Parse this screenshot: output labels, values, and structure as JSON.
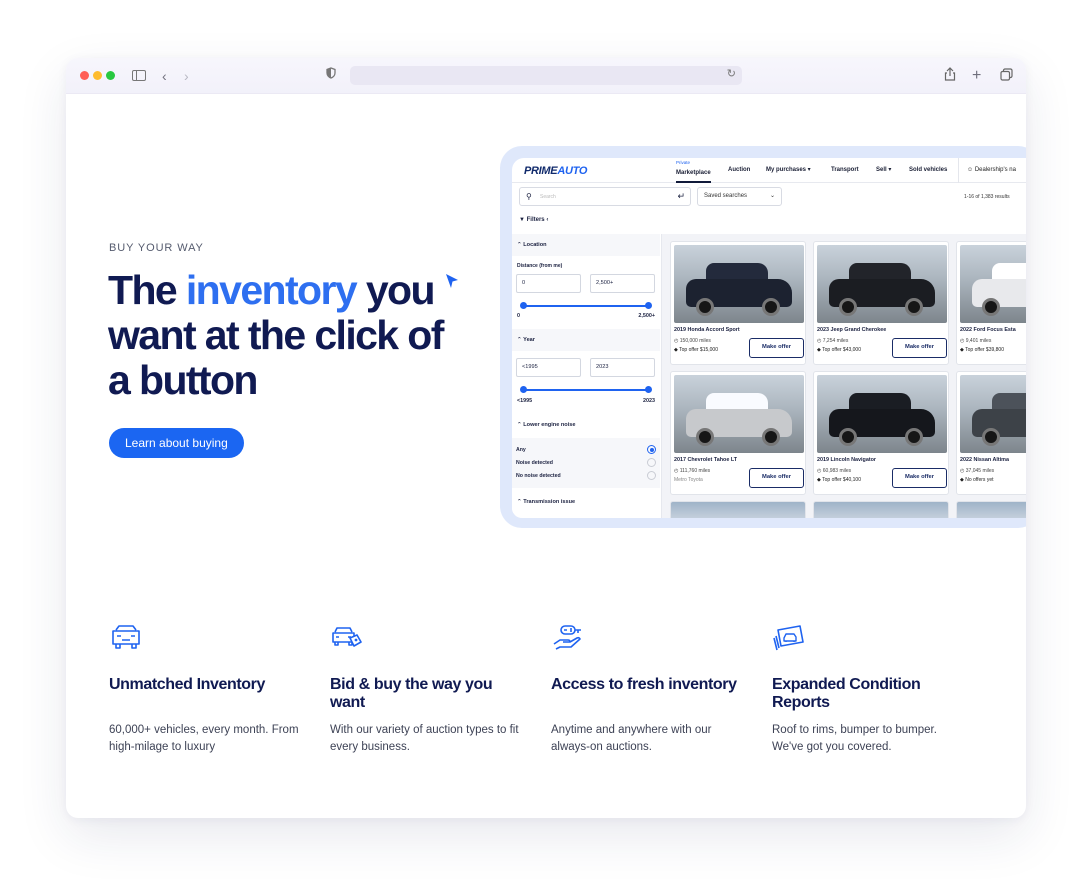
{
  "browser": {
    "window_controls": [
      "close",
      "minimize",
      "zoom"
    ],
    "icons": [
      "sidebar-icon",
      "back-icon",
      "forward-icon",
      "shield-icon",
      "reload-icon",
      "share-icon",
      "new-tab-icon",
      "tabs-overview-icon"
    ]
  },
  "hero": {
    "eyebrow": "BUY YOUR WAY",
    "headline_part1": "The ",
    "headline_accent": "inventory",
    "headline_part2": " you want at the click of a button",
    "cta_label": "Learn about buying",
    "accent_color": "#2e6ff0",
    "heading_color": "#101a52",
    "button_color": "#1b66f2"
  },
  "app": {
    "logo_part1": "PRIME",
    "logo_part2": "AUTO",
    "nav": [
      {
        "label": "Marketplace",
        "super": "Private"
      },
      {
        "label": "Auction"
      },
      {
        "label": "My purchases ▾"
      },
      {
        "label": "Transport"
      },
      {
        "label": "Sell ▾"
      },
      {
        "label": "Sold vehicles"
      },
      {
        "label": "Dealership's na"
      }
    ],
    "search_placeholder": "Search",
    "saved_searches": "Saved searches",
    "results": "1-16 of 1,383 results",
    "filters_label": "Filters",
    "filters": {
      "location": "Location",
      "distance_label": "Distance (from me)",
      "distance_min": "0",
      "distance_max": "2,500+",
      "distance_range_min": "0",
      "distance_range_max": "2,500+",
      "year": "Year",
      "year_min": "<1995",
      "year_max": "2023",
      "year_range_min": "<1995",
      "year_range_max": "2023",
      "engine_noise": "Lower engine noise",
      "noise_options": [
        "Any",
        "Noise detected",
        "No noise detected"
      ],
      "noise_selected": "Any",
      "transmission": "Transmission issue"
    },
    "make_offer_label": "Make offer",
    "cars": [
      {
        "title": "2019 Honda Accord Sport",
        "miles": "150,000 miles",
        "offer": "Top offer $15,000",
        "color": "#1c2230"
      },
      {
        "title": "2023 Jeep Grand Cherokee",
        "miles": "7,254 miles",
        "offer": "Top offer $43,000",
        "color": "#1b1d22"
      },
      {
        "title": "2022 Ford Focus Esta",
        "miles": "9,401 miles",
        "offer": "Top offer $39,800",
        "color": "#e8e9ec"
      },
      {
        "title": "2017 Chevrolet Tahoe LT",
        "miles": "111,760 miles",
        "offer": "Metro Toyota",
        "color": "#c7c9cc"
      },
      {
        "title": "2019 Lincoln Navigator",
        "miles": "60,983 miles",
        "offer": "Top offer $40,100",
        "color": "#15171c"
      },
      {
        "title": "2022 Nissan Altima",
        "miles": "37,045 miles",
        "offer": "No offers yet",
        "color": "#3d4248"
      }
    ]
  },
  "features": [
    {
      "icon": "car-icon",
      "title": "Unmatched Inventory",
      "desc": "60,000+ vehicles, every month. From high-milage to luxury"
    },
    {
      "icon": "car-tag-icon",
      "title": "Bid & buy the way you want",
      "desc": "With our variety of auction types to fit every business."
    },
    {
      "icon": "key-in-hand-icon",
      "title": "Access to fresh inventory",
      "desc": "Anytime and anywhere with our always-on auctions."
    },
    {
      "icon": "condition-report-icon",
      "title": "Expanded Condition Reports",
      "desc": "Roof to rims, bumper to bumper. We've got you covered."
    }
  ]
}
